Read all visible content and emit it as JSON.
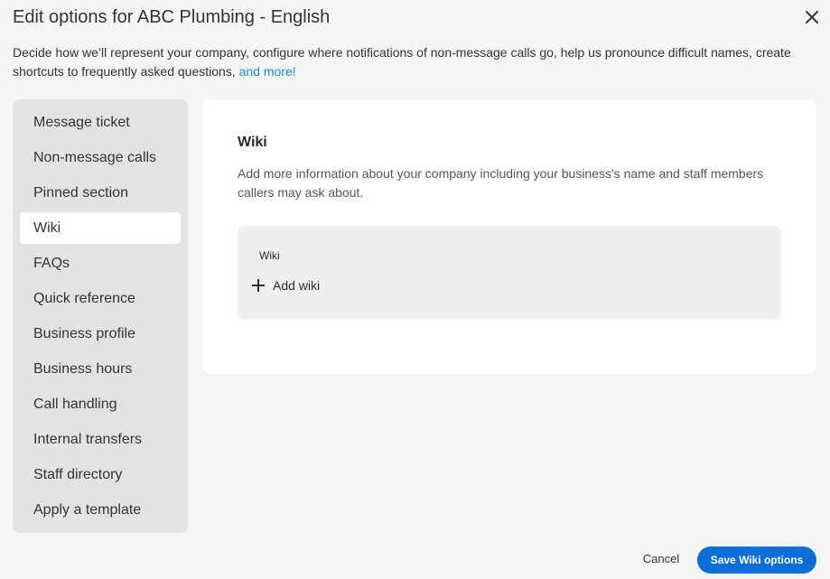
{
  "dialog": {
    "title": "Edit options for ABC Plumbing - English",
    "close_icon": "close-icon",
    "description": "Decide how we’ll represent your company, configure where notifications of non-message calls go, help us pronounce difficult names, create shortcuts to frequently asked questions, ",
    "description_link": "and more!"
  },
  "sidebar": {
    "items": [
      {
        "label": "Message ticket",
        "active": false
      },
      {
        "label": "Non-message calls",
        "active": false
      },
      {
        "label": "Pinned section",
        "active": false
      },
      {
        "label": "Wiki",
        "active": true
      },
      {
        "label": "FAQs",
        "active": false
      },
      {
        "label": "Quick reference",
        "active": false
      },
      {
        "label": "Business profile",
        "active": false
      },
      {
        "label": "Business hours",
        "active": false
      },
      {
        "label": "Call handling",
        "active": false
      },
      {
        "label": "Internal transfers",
        "active": false
      },
      {
        "label": "Staff directory",
        "active": false
      },
      {
        "label": "Apply a template",
        "active": false
      }
    ]
  },
  "main": {
    "section_title": "Wiki",
    "section_description": "Add more information about your company including your business's name and staff members callers may ask about.",
    "panel_label": "Wiki",
    "add_icon": "plus-icon",
    "add_label": "Add wiki"
  },
  "footer": {
    "cancel_label": "Cancel",
    "save_label": "Save Wiki options"
  },
  "colors": {
    "accent": "#0b6fd6",
    "link": "#1a8fd6",
    "sidebar_bg": "#e3e3e3",
    "page_bg": "#f5f5f5"
  }
}
